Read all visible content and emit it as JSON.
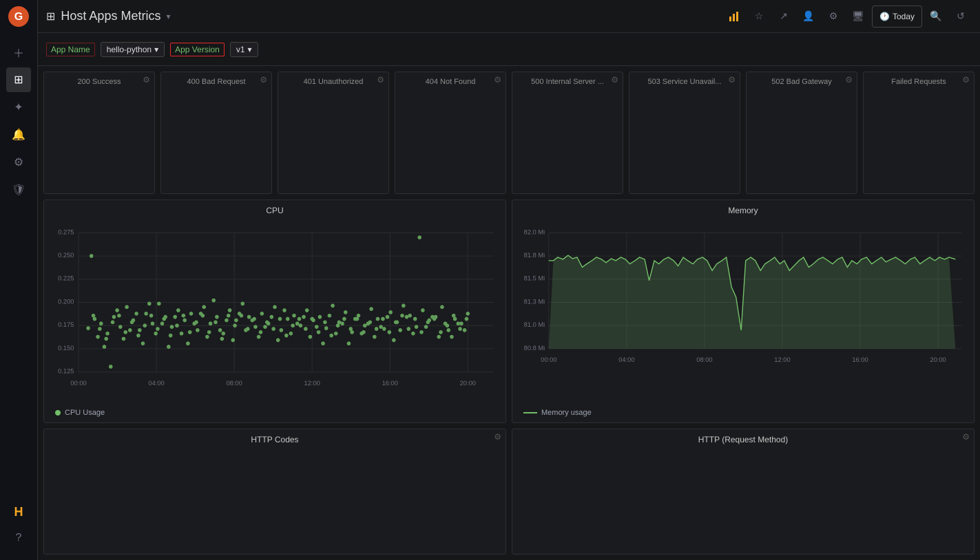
{
  "app": {
    "title": "Host Apps Metrics",
    "dropdown_icon": "▾"
  },
  "header": {
    "bar_icon": "⊞",
    "today_label": "Today",
    "buttons": [
      "chart-bar",
      "star",
      "share",
      "user",
      "settings",
      "monitor",
      "calendar",
      "search",
      "refresh"
    ]
  },
  "filters": {
    "app_name_label": "App Name",
    "app_name_value": "hello-python",
    "app_version_label": "App Version",
    "app_version_value": "v1"
  },
  "metric_panels": [
    {
      "title": "200 Success"
    },
    {
      "title": "400 Bad Request"
    },
    {
      "title": "401 Unauthorized"
    },
    {
      "title": "404 Not Found"
    },
    {
      "title": "500 Internal Server ..."
    },
    {
      "title": "503 Service Unavail..."
    },
    {
      "title": "502 Bad Gateway"
    },
    {
      "title": "Failed Requests"
    }
  ],
  "cpu_chart": {
    "title": "CPU",
    "legend": "CPU Usage",
    "y_labels": [
      "0.275",
      "0.250",
      "0.225",
      "0.200",
      "0.175",
      "0.150",
      "0.125"
    ],
    "x_labels": [
      "00:00",
      "04:00",
      "08:00",
      "12:00",
      "16:00",
      "20:00"
    ]
  },
  "memory_chart": {
    "title": "Memory",
    "legend": "Memory usage",
    "y_labels": [
      "82.0 Mi",
      "81.8 Mi",
      "81.5 Mi",
      "81.3 Mi",
      "81.0 Mi",
      "80.8 Mi"
    ],
    "x_labels": [
      "00:00",
      "04:00",
      "08:00",
      "12:00",
      "16:00",
      "20:00"
    ]
  },
  "http_codes_panel": {
    "title": "HTTP Codes"
  },
  "http_method_panel": {
    "title": "HTTP (Request Method)"
  },
  "sidebar": {
    "items": [
      "add",
      "apps",
      "star",
      "bell",
      "settings",
      "shield"
    ]
  }
}
